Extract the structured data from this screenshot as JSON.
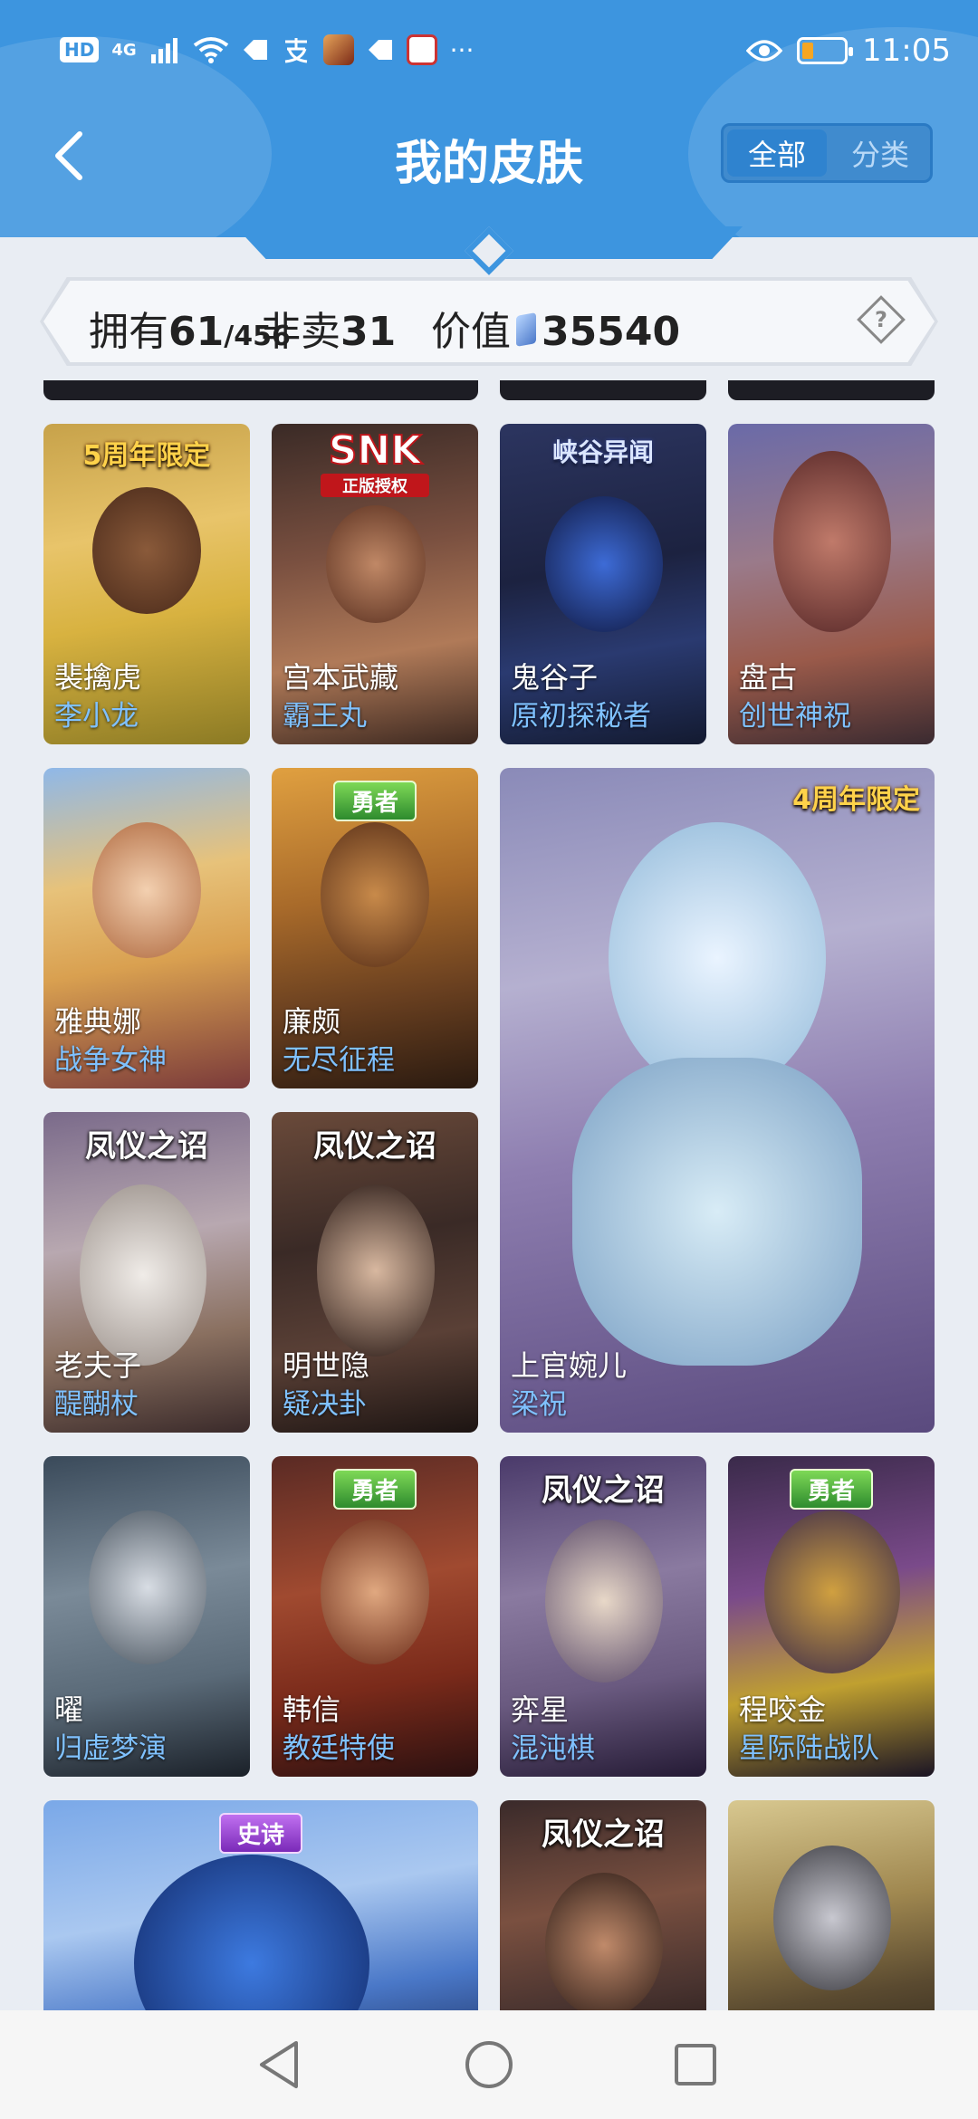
{
  "status_bar": {
    "hd_label": "HD",
    "network": "4G",
    "more": "···",
    "time": "11:05",
    "colors": {
      "battery": "#f6a623"
    }
  },
  "nav": {
    "back_icon": "chevron-left-icon",
    "title": "我的皮肤",
    "segments": [
      {
        "label": "全部",
        "active": true
      },
      {
        "label": "分类",
        "active": false
      }
    ]
  },
  "stats": {
    "own_label": "拥有",
    "own_count": "61",
    "own_total": "/456",
    "not_for_sale_label": "非卖",
    "not_for_sale_count": "31",
    "value_label": "价值",
    "value_amount": "35540",
    "help_symbol": "?"
  },
  "skins": [
    {
      "hero": "裴擒虎",
      "skin": "李小龙",
      "badge": "5周年限定",
      "badge_style": "gold"
    },
    {
      "hero": "宫本武藏",
      "skin": "霸王丸",
      "badge": "SNK",
      "badge_sub": "正版授权",
      "badge_style": "snk"
    },
    {
      "hero": "鬼谷子",
      "skin": "原初探秘者",
      "badge": "峡谷异闻",
      "badge_style": "blue"
    },
    {
      "hero": "盘古",
      "skin": "创世神祝",
      "badge": "",
      "badge_style": ""
    },
    {
      "hero": "雅典娜",
      "skin": "战争女神",
      "badge": "",
      "badge_style": ""
    },
    {
      "hero": "廉颇",
      "skin": "无尽征程",
      "badge": "勇者",
      "badge_style": "green"
    },
    {
      "hero": "上官婉儿",
      "skin": "梁祝",
      "badge": "4周年限定",
      "badge_style": "gold"
    },
    {
      "hero": "老夫子",
      "skin": "醍醐杖",
      "badge": "凤仪之诏",
      "badge_style": "feng"
    },
    {
      "hero": "明世隐",
      "skin": "疑决卦",
      "badge": "凤仪之诏",
      "badge_style": "feng"
    },
    {
      "hero": "曜",
      "skin": "归虚梦演",
      "badge": "",
      "badge_style": ""
    },
    {
      "hero": "韩信",
      "skin": "教廷特使",
      "badge": "勇者",
      "badge_style": "green"
    },
    {
      "hero": "弈星",
      "skin": "混沌棋",
      "badge": "凤仪之诏",
      "badge_style": "feng"
    },
    {
      "hero": "程咬金",
      "skin": "星际陆战队",
      "badge": "勇者",
      "badge_style": "green"
    },
    {
      "hero": "",
      "skin": "",
      "badge": "史诗",
      "badge_style": "purple"
    },
    {
      "hero": "",
      "skin": "",
      "badge": "凤仪之诏",
      "badge_style": "feng"
    },
    {
      "hero": "",
      "skin": "",
      "badge": "",
      "badge_style": ""
    }
  ],
  "system_nav": {
    "back_icon": "triangle-back-icon",
    "home_icon": "circle-home-icon",
    "recents_icon": "square-recents-icon"
  }
}
